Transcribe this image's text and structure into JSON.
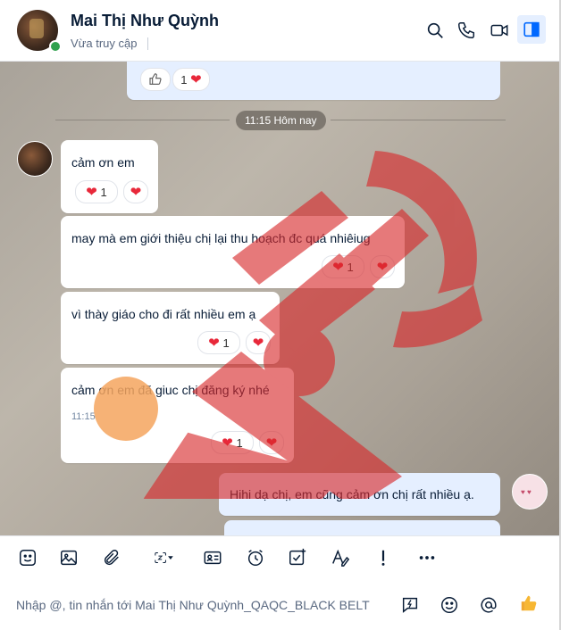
{
  "header": {
    "name": "Mai Thị Như Quỳnh",
    "status": "Vừa truy cập",
    "icons": [
      "search-icon",
      "phone-icon",
      "video-icon",
      "sidebar-toggle-icon"
    ]
  },
  "chat": {
    "prev_reaction_count": "1",
    "time_divider": "11:15 Hôm nay",
    "messages": [
      {
        "text": "cảm ơn em",
        "reaction_count": "1"
      },
      {
        "text": "may mà em giới thiệu chị lại thu hoạch đc quá nhiêiug",
        "reaction_count": "1"
      },
      {
        "text": "vì thày giáo cho đi rất nhiều em ạ",
        "reaction_count": "1"
      },
      {
        "text": "cảm ơn em đã giuc chị đăng ký nhé",
        "time": "11:15",
        "reaction_count": "1"
      }
    ],
    "my_message": "Hihi dạ chị, em cũng cảm ơn chị rất nhiều ạ."
  },
  "toolbar": {
    "icons": [
      "sticker-icon",
      "image-icon",
      "attachment-icon",
      "screenshot-icon",
      "contact-card-icon",
      "reminder-icon",
      "task-icon",
      "text-format-icon",
      "priority-icon",
      "more-icon"
    ]
  },
  "composer": {
    "placeholder": "Nhập @, tin nhắn tới Mai Thị Như Quỳnh_QAQC_BLACK BELT",
    "icons": [
      "quick-message-icon",
      "emoji-icon",
      "mention-icon",
      "thumbs-up-icon"
    ]
  },
  "colors": {
    "accent": "#0068ff",
    "heart": "#e8283a",
    "my_bubble": "#e5efff",
    "online": "#30a14e"
  }
}
